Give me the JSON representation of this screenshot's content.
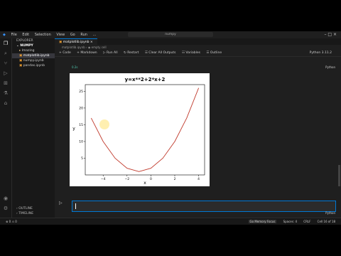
{
  "menu": {
    "items": [
      "File",
      "Edit",
      "Selection",
      "View",
      "Go",
      "Run",
      "..."
    ],
    "search": "numpy"
  },
  "sidebar": {
    "title": "EXPLORER",
    "folder": "NUMPY",
    "items": [
      {
        "label": "Imazing"
      },
      {
        "label": "matplotlib.ipynb"
      },
      {
        "label": "numpy.ipynb"
      },
      {
        "label": "pandas.ipynb"
      }
    ],
    "bottom": [
      "OUTLINE",
      "TIMELINE"
    ]
  },
  "editor": {
    "tab_label": "matplotlib.ipynb",
    "breadcrumb": "matplotlib.ipynb › ◉ empty cell",
    "toolbar": [
      "+ Code",
      "+ Markdown",
      "▷ Run All",
      "↻ Restart",
      "☰ Clear All Outputs",
      "☷ Variables",
      "☰ Outline"
    ],
    "kernel": "Python 3.11.2",
    "cell_lang": "Python",
    "exec_time": "0.2s"
  },
  "chart_data": {
    "type": "line",
    "title": "y=x**2+2*x+2",
    "xlabel": "x",
    "ylabel": "y",
    "xlim": [
      -5.5,
      4.5
    ],
    "ylim": [
      0,
      27
    ],
    "xticks": [
      -4,
      -2,
      0,
      2,
      4
    ],
    "yticks": [
      5,
      10,
      15,
      20,
      25
    ],
    "x": [
      -5,
      -4,
      -3,
      -2,
      -1,
      0,
      1,
      2,
      3,
      4
    ],
    "series": [
      {
        "values": [
          17,
          10,
          5,
          2,
          1,
          2,
          5,
          10,
          17,
          26
        ],
        "color": "#c0392b"
      }
    ]
  },
  "status": {
    "left": "⊗ 0 ⚠ 0",
    "items": [
      "Go Memory Focus",
      "Spaces: 4",
      "CRLF",
      "Cell 16 of 18"
    ]
  }
}
